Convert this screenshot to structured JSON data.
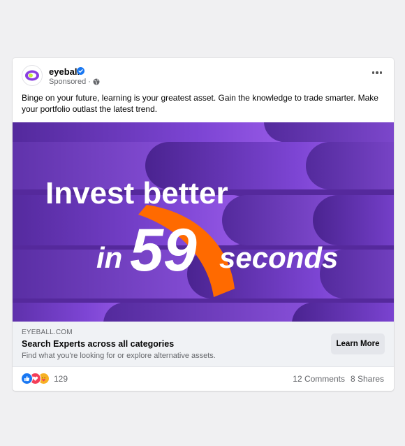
{
  "post": {
    "page_name": "eyeball",
    "sponsored_label": "Sponsored",
    "caption": "Binge on your future, learning is your greatest asset. Gain the knowledge to trade smarter. Make your portfolio outlast the latest trend.",
    "icons": [
      "eyeball-logo-icon",
      "verified-badge-icon",
      "globe-icon",
      "more-options-icon"
    ]
  },
  "creative": {
    "line1": "Invest better",
    "line2_in": "in",
    "line2_number": "59",
    "line2_seconds": "seconds",
    "colors": {
      "background": "#5a2fa0",
      "accent": "#ff6a00",
      "text": "#ffffff"
    }
  },
  "link": {
    "domain": "EYEBALL.COM",
    "headline": "Search Experts across all categories",
    "description": "Find what you're looking for or explore alternative assets.",
    "cta_label": "Learn More"
  },
  "engagement": {
    "reaction_count": "129",
    "reaction_icons": [
      "like-icon",
      "love-icon",
      "care-icon"
    ],
    "comments": "12 Comments",
    "shares": "8 Shares"
  }
}
